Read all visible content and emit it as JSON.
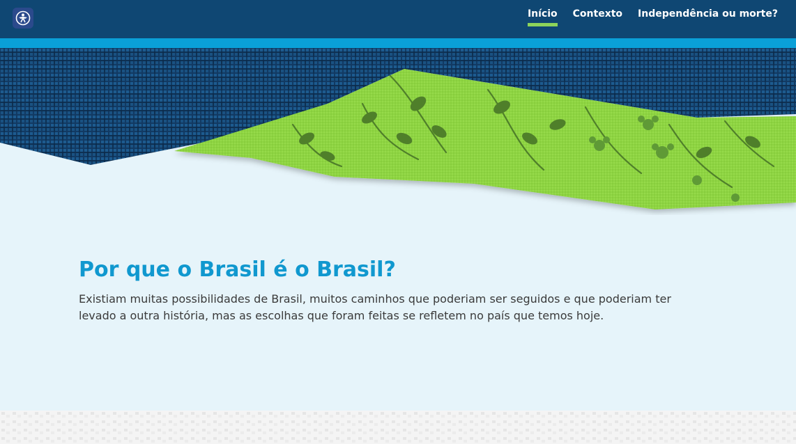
{
  "header": {
    "logo_icon": "handshake-emblem-icon",
    "nav": [
      {
        "label": "Início",
        "active": true
      },
      {
        "label": "Contexto",
        "active": false
      },
      {
        "label": "Independência ou morte?",
        "active": false
      }
    ],
    "colors": {
      "bar": "#0f4773",
      "accent": "#0aa0d8",
      "active_underline": "#8cd45a"
    }
  },
  "hero": {
    "title": "Por que o Brasil é o Brasil?",
    "body": "Existiam muitas possibilidades de Brasil, muitos caminhos que poderiam ser seguidos e que poderiam ter levado a outra história, mas as escolhas que foram feitas se refletem no país que temos hoje.",
    "colors": {
      "title": "#1098cf",
      "background": "#e6f4fa"
    }
  },
  "banner": {
    "icon": "fabric-texture-banner"
  }
}
